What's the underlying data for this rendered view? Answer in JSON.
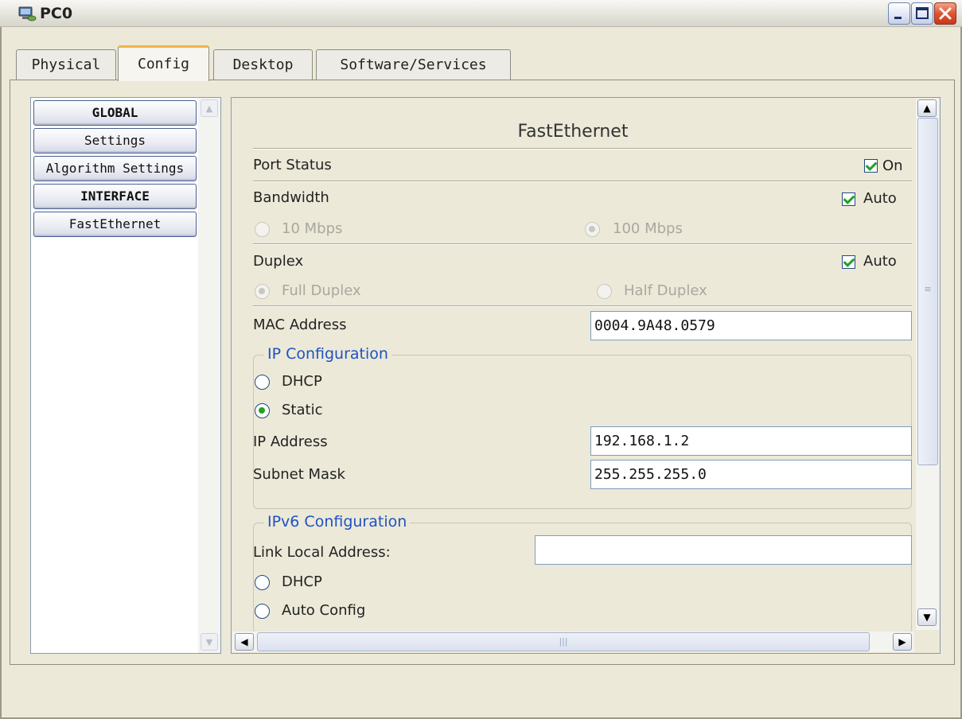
{
  "window": {
    "title": "PC0",
    "app_icon": "pc-device-icon",
    "controls": [
      "minimize-icon",
      "maximize-icon",
      "close-icon"
    ]
  },
  "tabs": [
    {
      "label": "Physical",
      "active": false
    },
    {
      "label": "Config",
      "active": true
    },
    {
      "label": "Desktop",
      "active": false
    },
    {
      "label": "Software/Services",
      "active": false
    }
  ],
  "sidebar": {
    "items": [
      {
        "label": "GLOBAL",
        "header": true
      },
      {
        "label": "Settings",
        "header": false
      },
      {
        "label": "Algorithm Settings",
        "header": false
      },
      {
        "label": "INTERFACE",
        "header": true
      },
      {
        "label": "FastEthernet",
        "header": false
      }
    ]
  },
  "interface": {
    "heading": "FastEthernet",
    "port_status": {
      "label": "Port Status",
      "checkbox_label": "On",
      "checked": true
    },
    "bandwidth": {
      "label": "Bandwidth",
      "checkbox_label": "Auto",
      "checked": true,
      "options": [
        {
          "label": "10 Mbps",
          "selected": false
        },
        {
          "label": "100 Mbps",
          "selected": true
        }
      ]
    },
    "duplex": {
      "label": "Duplex",
      "checkbox_label": "Auto",
      "checked": true,
      "options": [
        {
          "label": "Full Duplex",
          "selected": true
        },
        {
          "label": "Half Duplex",
          "selected": false
        }
      ]
    },
    "mac": {
      "label": "MAC Address",
      "value": "0004.9A48.0579"
    },
    "ip_config": {
      "title": "IP Configuration",
      "options": [
        {
          "label": "DHCP",
          "selected": false
        },
        {
          "label": "Static",
          "selected": true
        }
      ],
      "ip_address": {
        "label": "IP Address",
        "value": "192.168.1.2"
      },
      "subnet_mask": {
        "label": "Subnet Mask",
        "value": "255.255.255.0"
      }
    },
    "ipv6_config": {
      "title": "IPv6 Configuration",
      "link_local": {
        "label": "Link Local Address:",
        "value": ""
      },
      "options": [
        {
          "label": "DHCP",
          "selected": false
        },
        {
          "label": "Auto Config",
          "selected": false
        }
      ]
    }
  },
  "colors": {
    "window_bg": "#ece9d8",
    "group_title": "#1f52c4",
    "active_tab_accent": "#f2b347",
    "check_green": "#21a121"
  }
}
